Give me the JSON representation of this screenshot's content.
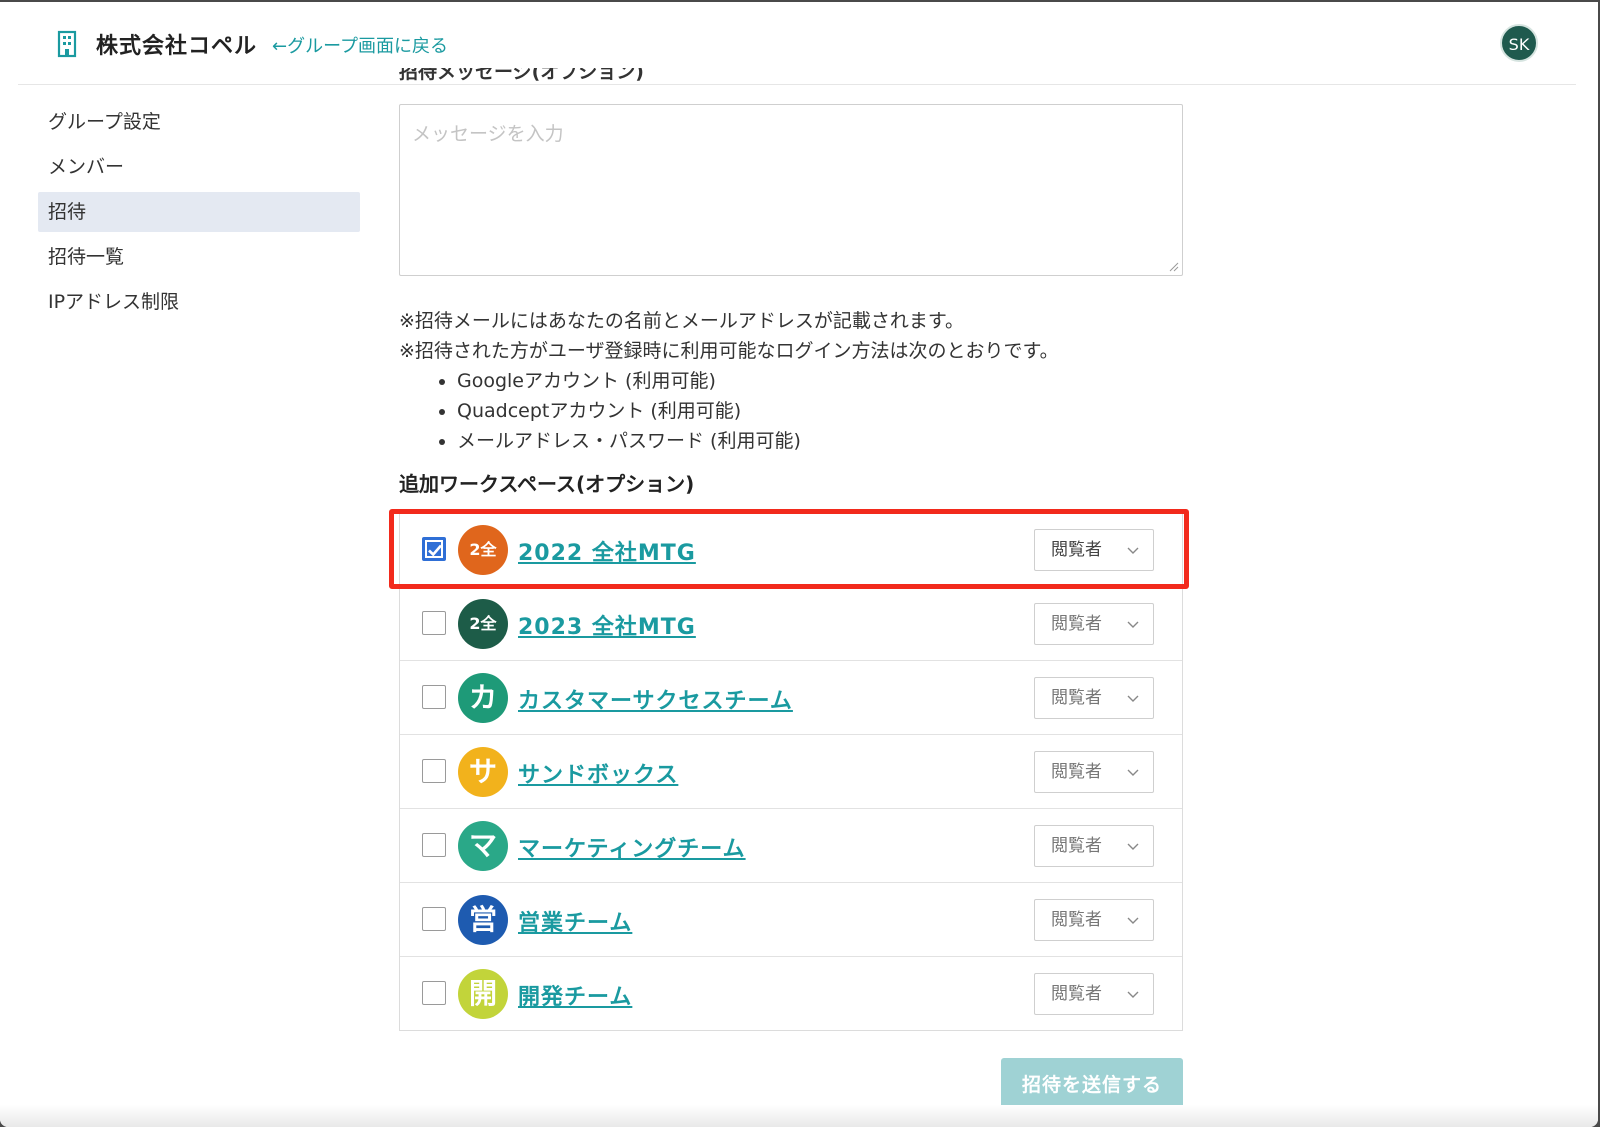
{
  "header": {
    "company_name": "株式会社コペル",
    "back_link": "←グループ画面に戻る",
    "avatar_initials": "SK"
  },
  "sidebar": {
    "items": [
      {
        "label": "グループ設定",
        "active": false
      },
      {
        "label": "メンバー",
        "active": false
      },
      {
        "label": "招待",
        "active": true
      },
      {
        "label": "招待一覧",
        "active": false
      },
      {
        "label": "IPアドレス制限",
        "active": false
      }
    ]
  },
  "message": {
    "section_label": "招待メッセージ(オプション)",
    "placeholder": "メッセージを入力",
    "value": ""
  },
  "notes": {
    "line1": "※招待メールにはあなたの名前とメールアドレスが記載されます。",
    "line2": "※招待された方がユーザ登録時に利用可能なログイン方法は次のとおりです。",
    "methods": [
      "Googleアカウント (利用可能)",
      "Quadceptアカウント (利用可能)",
      "メールアドレス・パスワード (利用可能)"
    ]
  },
  "workspaces": {
    "title": "追加ワークスペース(オプション)",
    "items": [
      {
        "name": "2022 全社MTG",
        "icon_text": "2全",
        "icon_color": "#e0661c",
        "checked": true,
        "role": "閲覧者"
      },
      {
        "name": "2023 全社MTG",
        "icon_text": "2全",
        "icon_color": "#1d5c48",
        "checked": false,
        "role": "閲覧者"
      },
      {
        "name": "カスタマーサクセスチーム",
        "icon_text": "カ",
        "icon_color": "#1e9a78",
        "checked": false,
        "role": "閲覧者"
      },
      {
        "name": "サンドボックス",
        "icon_text": "サ",
        "icon_color": "#f2b21c",
        "checked": false,
        "role": "閲覧者"
      },
      {
        "name": "マーケティングチーム",
        "icon_text": "マ",
        "icon_color": "#2aa888",
        "checked": false,
        "role": "閲覧者"
      },
      {
        "name": "営業チーム",
        "icon_text": "営",
        "icon_color": "#1e5bb0",
        "checked": false,
        "role": "閲覧者"
      },
      {
        "name": "開発チーム",
        "icon_text": "開",
        "icon_color": "#c2d43a",
        "checked": false,
        "role": "閲覧者"
      }
    ]
  },
  "actions": {
    "send_label": "招待を送信する"
  },
  "colors": {
    "accent": "#1a9aa0",
    "highlight_border": "#f22a1c",
    "checkbox_checked": "#2f6fd6",
    "send_button_disabled": "#9fd2d4"
  }
}
